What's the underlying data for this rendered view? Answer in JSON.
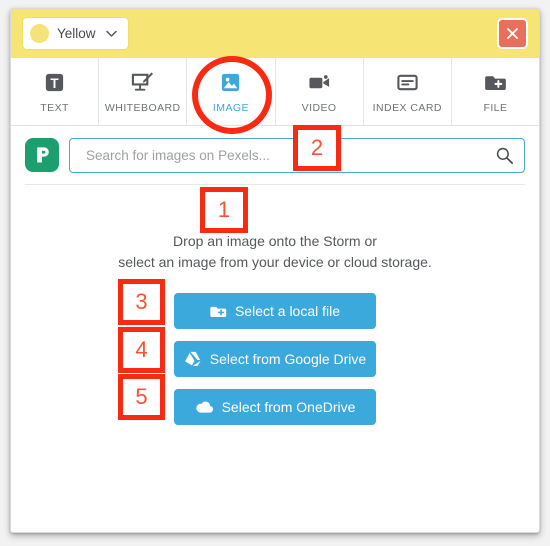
{
  "header": {
    "color_label": "Yellow",
    "color_swatch_hex": "#f5e37a",
    "header_bg_hex": "#f6e574",
    "chevron_icon": "chevron-down-icon",
    "close_icon": "close-icon",
    "close_bg_hex": "#e8705a"
  },
  "tabs": [
    {
      "label": "TEXT",
      "icon": "text-icon",
      "active": false
    },
    {
      "label": "WHITEBOARD",
      "icon": "whiteboard-icon",
      "active": false
    },
    {
      "label": "IMAGE",
      "icon": "image-icon",
      "active": true
    },
    {
      "label": "VIDEO",
      "icon": "video-icon",
      "active": false
    },
    {
      "label": "INDEX CARD",
      "icon": "index-card-icon",
      "active": false
    },
    {
      "label": "FILE",
      "icon": "file-add-icon",
      "active": false
    }
  ],
  "search": {
    "logo_name": "pexels-logo",
    "logo_hex": "#1d9e6e",
    "placeholder": "Search for images on Pexels...",
    "value": "",
    "search_icon": "search-icon",
    "border_hex": "#4aa8de"
  },
  "drop": {
    "line1": "Drop an image onto the Storm or",
    "line2": "select an image from your device or cloud storage."
  },
  "buttons": [
    {
      "label": "Select a local file",
      "icon": "folder-add-icon"
    },
    {
      "label": "Select from Google Drive",
      "icon": "google-drive-icon"
    },
    {
      "label": "Select from OneDrive",
      "icon": "onedrive-cloud-icon"
    }
  ],
  "button_color_hex": "#3ca9dd",
  "annotations": {
    "circle_target": "IMAGE",
    "accent_hex": "#f92a12",
    "markers": [
      "1",
      "2",
      "3",
      "4",
      "5"
    ]
  }
}
